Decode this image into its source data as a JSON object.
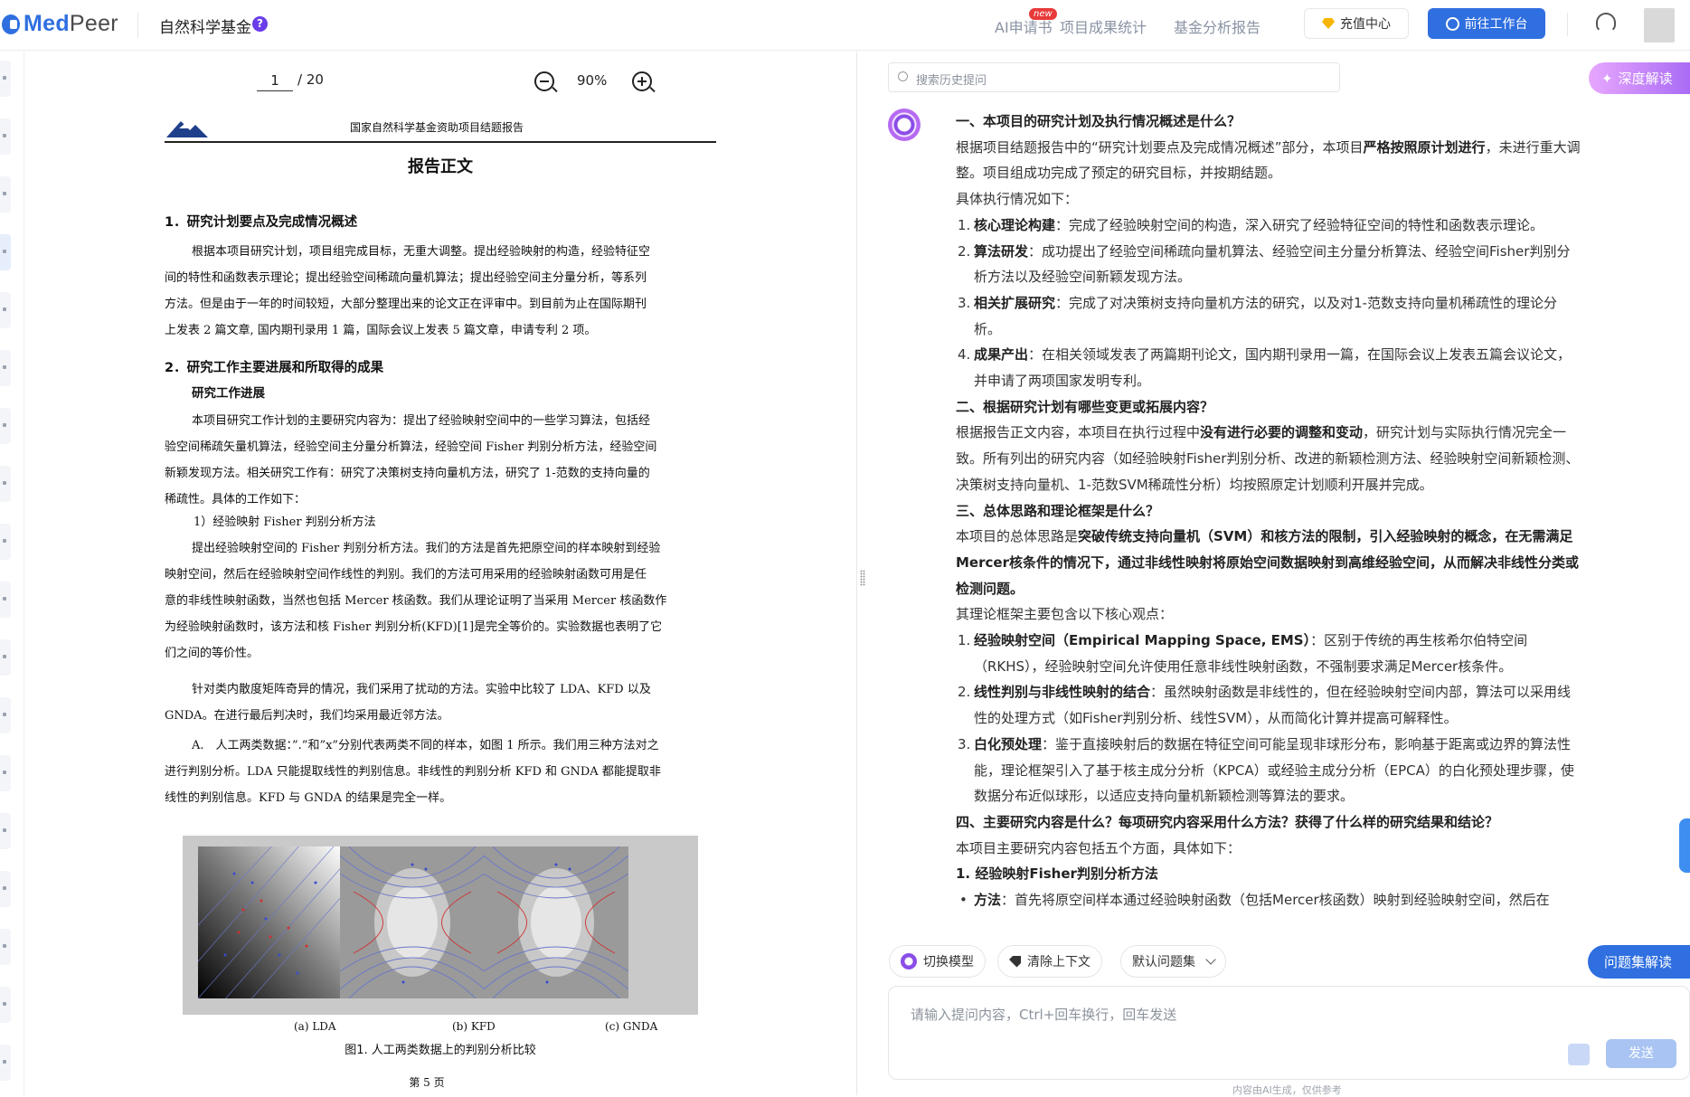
{
  "header": {
    "logo_main": "Med",
    "logo_accent": "Peer",
    "app_title": "自然科学基金",
    "help_mark": "?",
    "nav": [
      "AI申请书",
      "项目成果统计",
      "基金分析报告"
    ],
    "new_badge": "new",
    "recharge_label": "充值中心",
    "workbench_label": "前往工作台",
    "accent_color": "#2f6fe0"
  },
  "pdf": {
    "current_page": "1",
    "total_pages": "/ 20",
    "zoom": "90%",
    "header_text": "国家自然科学基金资助项目结题报告",
    "title": "报告正文",
    "h1": "1．研究计划要点及完成情况概述",
    "p1_l1": "根据本项目研究计划，项目组完成目标，无重大调整。提出经验映射的构造，经验特征空",
    "p1_l2": "间的特性和函数表示理论；提出经验空间稀疏向量机算法；提出经验空间主分量分析，等系列",
    "p1_l3": "方法。但是由于一年的时间较短，大部分整理出来的论文正在评审中。到目前为止在国际期刊",
    "p1_l4": "上发表 2 篇文章, 国内期刊录用 1 篇，国际会议上发表 5 篇文章，申请专利 2 项。",
    "h2": "2．研究工作主要进展和所取得的成果",
    "sub": "研究工作进展",
    "p2_l1": "本项目研究工作计划的主要研究内容为：提出了经验映射空间中的一些学习算法，包括经",
    "p2_l2": "验空间稀疏矢量机算法，经验空间主分量分析算法，经验空间 Fisher 判别分析方法，经验空间",
    "p2_l3": "新颖发现方法。相关研究工作有：研究了决策树支持向量机方法，研究了 1-范数的支持向量的",
    "p2_l4": "稀疏性。具体的工作如下：",
    "item1": "1）经验映射 Fisher 判别分析方法",
    "p3_l1": "提出经验映射空间的 Fisher 判别分析方法。我们的方法是首先把原空间的样本映射到经验",
    "p3_l2": "映射空间，然后在经验映射空间作线性的判别。我们的方法可用采用的经验映射函数可用是任",
    "p3_l3": "意的非线性映射函数，当然也包括 Mercer 核函数。我们从理论证明了当采用 Mercer 核函数作",
    "p3_l4": "为经验映射函数时，该方法和核 Fisher 判别分析(KFD)[1]是完全等价的。实验数据也表明了它",
    "p3_l5": "们之间的等价性。",
    "p4_l1": "针对类内散度矩阵奇异的情况，我们采用了扰动的方法。实验中比较了 LDA、KFD 以及",
    "p4_l2": "GNDA。在进行最后判决时，我们均采用最近邻方法。",
    "p5_l1": "A.　人工两类数据：”.”和”x”分别代表两类不同的样本，如图 1 所示。我们用三种方法对之",
    "p5_l2": "进行判别分析。LDA 只能提取线性的判别信息。非线性的判别分析 KFD 和 GNDA 都能提取非",
    "p5_l3": "线性的判别信息。KFD 与 GNDA 的结果是完全一样。",
    "fig_captions": [
      "(a) LDA",
      "(b) KFD",
      "(c) GNDA"
    ],
    "fig_title": "图1. 人工两类数据上的判别分析比较",
    "page_num": "第 5 页"
  },
  "ai": {
    "history_placeholder": "搜索历史提问",
    "deep_read_label": "深度解读",
    "q1": "一、本项目的研究计划及执行情况概述是什么？",
    "a1_1a": "根据项目结题报告中的“研究计划要点及完成情况概述”部分，本项目",
    "a1_1b": "严格按照原计划进行",
    "a1_1c": "，未进行重大调整。项目组成功完成了预定的研究目标，并按期结题。",
    "a1_2": "具体执行情况如下：",
    "l1": [
      {
        "n": "1.",
        "k": "核心理论构建",
        "t": "：完成了经验映射空间的构造，深入研究了经验特征空间的特性和函数表示理论。"
      },
      {
        "n": "2.",
        "k": "算法研发",
        "t": "：成功提出了经验空间稀疏向量机算法、经验空间主分量分析算法、经验空间Fisher判别分析方法以及经验空间新颖发现方法。"
      },
      {
        "n": "3.",
        "k": "相关扩展研究",
        "t": "：完成了对决策树支持向量机方法的研究，以及对1-范数支持向量机稀疏性的理论分析。"
      },
      {
        "n": "4.",
        "k": "成果产出",
        "t": "：在相关领域发表了两篇期刊论文，国内期刊录用一篇，在国际会议上发表五篇会议论文，并申请了两项国家发明专利。"
      }
    ],
    "q2": "二、根据研究计划有哪些变更或拓展内容？",
    "a2a": "根据报告正文内容，本项目在执行过程中",
    "a2b": "没有进行必要的调整和变动",
    "a2c": "，研究计划与实际执行情况完全一致。所有列出的研究内容（如经验映射Fisher判别分析、改进的新颖检测方法、经验映射空间新颖检测、决策树支持向量机、1-范数SVM稀疏性分析）均按照原定计划顺利开展并完成。",
    "q3": "三、总体思路和理论框架是什么？",
    "a3a": "本项目的总体思路是",
    "a3b": "突破传统支持向量机（SVM）和核方法的限制，引入经验映射的概念，在无需满足Mercer核条件的情况下，通过非线性映射将原始空间数据映射到高维经验空间，从而解决非线性分类或检测问题。",
    "a3c": "其理论框架主要包含以下核心观点：",
    "l3": [
      {
        "n": "1.",
        "k": "经验映射空间（Empirical Mapping Space, EMS）",
        "t": "：区别于传统的再生核希尔伯特空间（RKHS），经验映射空间允许使用任意非线性映射函数，不强制要求满足Mercer核条件。"
      },
      {
        "n": "2.",
        "k": "线性判别与非线性映射的结合",
        "t": "：虽然映射函数是非线性的，但在经验映射空间内部，算法可以采用线性的处理方式（如Fisher判别分析、线性SVM），从而简化计算并提高可解释性。"
      },
      {
        "n": "3.",
        "k": "白化预处理",
        "t": "：鉴于直接映射后的数据在特征空间可能呈现非球形分布，影响基于距离或边界的算法性能，理论框架引入了基于核主成分分析（KPCA）或经验主成分分析（EPCA）的白化预处理步骤，使数据分布近似球形，以适应支持向量机新颖检测等算法的要求。"
      }
    ],
    "q4": "四、主要研究内容是什么？每项研究内容采用什么方法？获得了什么样的研究结果和结论？",
    "a4": "本项目主要研究内容包括五个方面，具体如下：",
    "sec1": "1. 经验映射Fisher判别分析方法",
    "bullet_k": "方法",
    "bullet_t": "：首先将原空间样本通过经验映射函数（包括Mercer核函数）映射到经验映射空间，然后在",
    "chip_model": "切换模型",
    "chip_clear": "清除上下文",
    "chip_default": "默认问题集",
    "qset_label": "问题集解读",
    "input_placeholder": "请输入提问内容，Ctrl+回车换行，回车发送",
    "send_label": "发送",
    "disclaimer": "内容由AI生成，仅供参考"
  }
}
